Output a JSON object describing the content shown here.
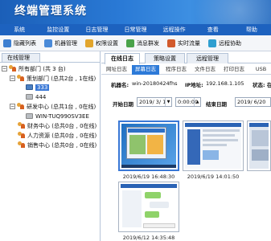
{
  "app": {
    "title": "终端管理系统"
  },
  "menu": [
    {
      "label": "系统"
    },
    {
      "label": "监控设置"
    },
    {
      "label": "日志管理"
    },
    {
      "label": "日常管理"
    },
    {
      "label": "远程操作"
    },
    {
      "label": "查看"
    },
    {
      "label": "帮助"
    }
  ],
  "toolbar": [
    {
      "label": "隐藏列表",
      "icon": "list-icon",
      "color": "#3d7fd1"
    },
    {
      "label": "机器管理",
      "icon": "computer-icon",
      "color": "#4a8ad8"
    },
    {
      "label": "权限设置",
      "icon": "key-icon",
      "color": "#e2a52c"
    },
    {
      "label": "消息群发",
      "icon": "message-icon",
      "color": "#4aa34a"
    },
    {
      "label": "实时流量",
      "icon": "traffic-icon",
      "color": "#d25a2c"
    },
    {
      "label": "远程协助",
      "icon": "remote-icon",
      "color": "#2f9fd0"
    }
  ],
  "left_panel": {
    "tab": "在线管理",
    "tree": {
      "root": "所有部门 (共 3 台)",
      "groups": [
        {
          "label": "策划部门 (总共2台 , 1在线)",
          "children": [
            "333",
            "444"
          ]
        },
        {
          "label": "研发中心 (总共1台 , 0在线)",
          "children": [
            "WIN-TUQ990SV3EE"
          ]
        },
        {
          "label": "财务中心 (总共0台 , 0在线)",
          "children": []
        },
        {
          "label": "人力资源 (总共0台 , 0在线)",
          "children": []
        },
        {
          "label": "销售中心 (总共0台 , 0在线)",
          "children": []
        }
      ],
      "selected": "333"
    }
  },
  "tabs_main": [
    {
      "label": "在线日志",
      "active": true
    },
    {
      "label": "策略设置",
      "active": false
    },
    {
      "label": "远程管理",
      "active": false
    }
  ],
  "tabs_log": [
    {
      "label": "网址日志",
      "active": false
    },
    {
      "label": "屏幕日志",
      "active": true
    },
    {
      "label": "程序日志",
      "active": false
    },
    {
      "label": "文件日志",
      "active": false
    },
    {
      "label": "打印日志",
      "active": false
    },
    {
      "label": "USB",
      "active": false
    }
  ],
  "info": {
    "machine_label": "机器名:",
    "machine_value": "win-20180424fhs",
    "ip_label": "IP地址:",
    "ip_value": "192.168.1.105",
    "status_label": "状态: 在"
  },
  "dates": {
    "start_label": "开始日期",
    "start_date": "2019/ 3/ 1",
    "start_time": "0:00:00",
    "end_label": "结束日期",
    "end_date": "2019/ 6/20"
  },
  "screenshots": [
    {
      "caption": "2019/6/19 16:48:30",
      "selected": true,
      "theme": "desktop"
    },
    {
      "caption": "2019/6/19 14:01:50",
      "selected": false,
      "theme": "document"
    },
    {
      "caption": "",
      "selected": false,
      "theme": "window"
    },
    {
      "caption": "2019/6/12 14:35:48",
      "selected": false,
      "theme": "chat"
    }
  ]
}
